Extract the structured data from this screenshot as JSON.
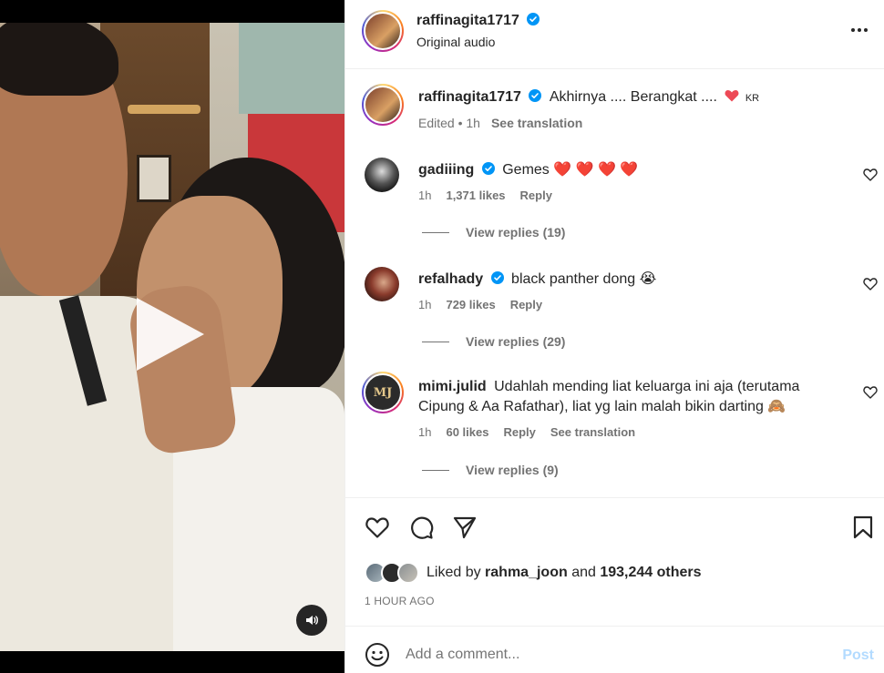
{
  "media": {
    "play_icon": "play-icon",
    "audio_icon": "speaker-icon"
  },
  "header": {
    "username": "raffinagita1717",
    "audio": "Original audio",
    "more_icon": "more-icon"
  },
  "caption": {
    "username": "raffinagita1717",
    "text": "Akhirnya .... Berangkat ....",
    "suffix": "KR",
    "edited": "Edited",
    "time": "1h",
    "translate": "See translation"
  },
  "comments": [
    {
      "username": "gadiiing",
      "text": "Gemes ❤️ ❤️ ❤️ ❤️",
      "time": "1h",
      "likes": "1,371 likes",
      "reply": "Reply",
      "view_replies": "View replies (19)"
    },
    {
      "username": "refalhady",
      "text": "black panther dong 😭",
      "time": "1h",
      "likes": "729 likes",
      "reply": "Reply",
      "view_replies": "View replies (29)"
    },
    {
      "username": "mimi.julid",
      "text": "Udahlah mending liat keluarga ini aja (terutama Cipung & Aa Rafathar), liat yg lain malah bikin darting 🙈",
      "time": "1h",
      "likes": "60 likes",
      "reply": "Reply",
      "translate": "See translation",
      "view_replies": "View replies (9)",
      "avatar_initials": "MJ"
    }
  ],
  "actions": {
    "liked_by_prefix": "Liked by",
    "liked_by_user": "rahma_joon",
    "and": "and",
    "others": "193,244 others",
    "timestamp": "1 HOUR AGO"
  },
  "comment_box": {
    "placeholder": "Add a comment...",
    "post": "Post"
  },
  "colors": {
    "verified": "#0095f6",
    "heart": "#ed4956",
    "post_disabled": "#b3dbff"
  }
}
